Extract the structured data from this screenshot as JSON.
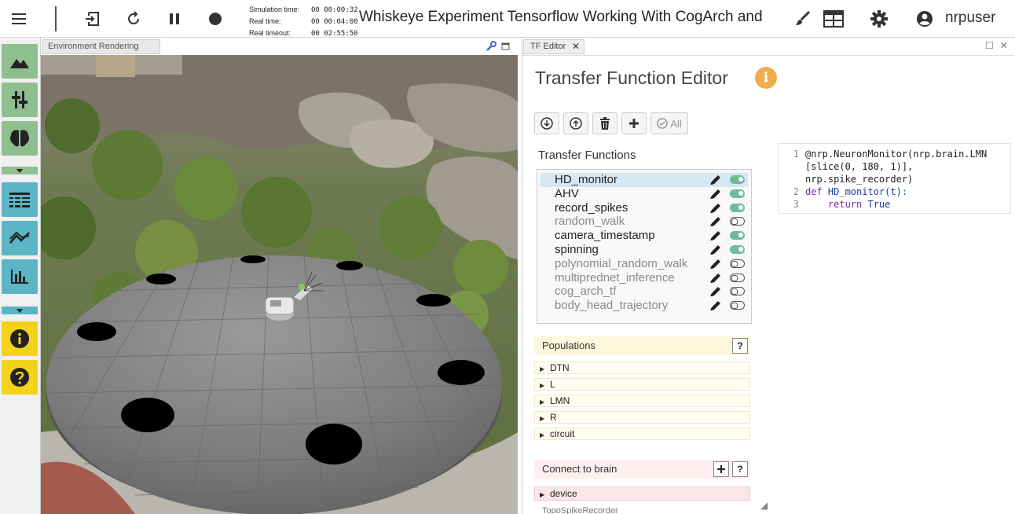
{
  "topbar": {
    "menu_icon": "hamburger-icon",
    "exit_icon": "exit-icon",
    "reset_icon": "reset-icon",
    "pause_icon": "pause-icon",
    "record_icon": "record-icon",
    "sim_time_label": "Simulation time:",
    "sim_time_value": "00 00:00:32",
    "real_time_label": "Real time:",
    "real_time_value": "00 00:04:00",
    "real_timeout_label": "Real timeout:",
    "real_timeout_value": "00 02:55:50",
    "experiment_title": "Whiskeye Experiment Tensorflow Working With CogArch and",
    "user_name": "nrpuser"
  },
  "scene": {
    "tab_label": "Environment Rendering"
  },
  "editor": {
    "tab_label": "TF Editor",
    "title": "Transfer Function Editor",
    "toolbar": {
      "all_label": "All"
    },
    "tf_heading": "Transfer Functions",
    "transfer_functions": [
      {
        "name": "HD_monitor",
        "enabled": true,
        "selected": true
      },
      {
        "name": "AHV",
        "enabled": true,
        "selected": false
      },
      {
        "name": "record_spikes",
        "enabled": true,
        "selected": false
      },
      {
        "name": "random_walk",
        "enabled": false,
        "selected": false
      },
      {
        "name": "camera_timestamp",
        "enabled": true,
        "selected": false
      },
      {
        "name": "spinning",
        "enabled": true,
        "selected": false
      },
      {
        "name": "polynomial_random_walk",
        "enabled": false,
        "selected": false
      },
      {
        "name": "multiprednet_inference",
        "enabled": false,
        "selected": false
      },
      {
        "name": "cog_arch_tf",
        "enabled": false,
        "selected": false
      },
      {
        "name": "body_head_trajectory",
        "enabled": false,
        "selected": false
      }
    ],
    "populations_heading": "Populations",
    "populations": [
      "DTN",
      "L",
      "LMN",
      "R",
      "circuit"
    ],
    "help_label": "?",
    "connect_heading": "Connect to brain",
    "connect_items": [
      "device"
    ],
    "connect_next_partial": "TopoSpikeRecorder",
    "code": {
      "line_numbers": [
        "1",
        "",
        "",
        "2",
        "3"
      ],
      "decorator": "@nrp.NeuronMonitor(nrp.brain.LMN",
      "slice_line": "[slice(0, 180, 1)],",
      "recorder_line": "nrp.spike_recorder)",
      "def_line": "HD_monitor(t):",
      "return_line": "True"
    }
  },
  "colors": {
    "green_btn": "#8fbf8f",
    "teal_btn": "#5bb5c5",
    "yellow_btn": "#f3d21a",
    "info_orange": "#f0ad4e",
    "toggle_on": "#6dbd9c"
  }
}
